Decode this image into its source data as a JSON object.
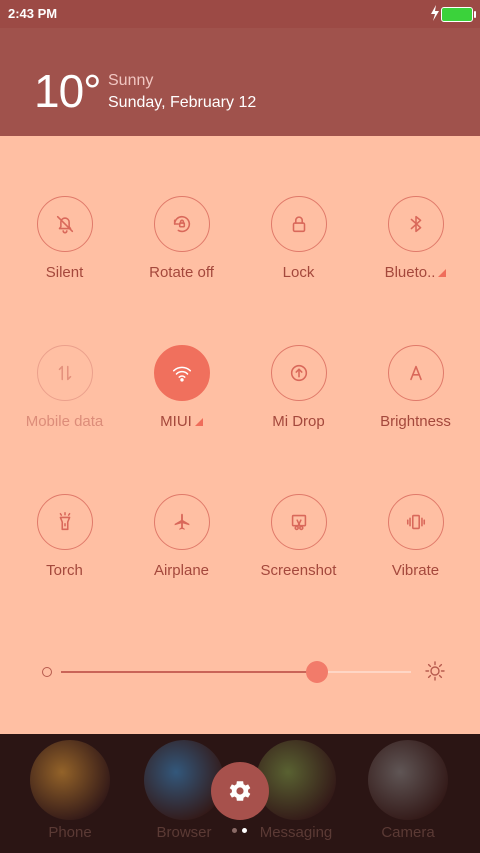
{
  "status_bar": {
    "time": "2:43 PM",
    "battery_color": "#3bd23b"
  },
  "weather": {
    "temperature": "10°",
    "condition": "Sunny",
    "date": "Sunday, February 12"
  },
  "toggles": [
    {
      "label": "Silent",
      "icon": "bell-off-icon",
      "state": "off"
    },
    {
      "label": "Rotate off",
      "icon": "rotate-lock-icon",
      "state": "off"
    },
    {
      "label": "Lock",
      "icon": "lock-icon",
      "state": "off"
    },
    {
      "label": "Blueto..",
      "icon": "bluetooth-icon",
      "state": "off",
      "has_submenu": true
    },
    {
      "label": "Mobile data",
      "icon": "mobile-data-icon",
      "state": "disabled"
    },
    {
      "label": "MIUI",
      "icon": "wifi-icon",
      "state": "on",
      "has_submenu": true
    },
    {
      "label": "Mi Drop",
      "icon": "upload-icon",
      "state": "off"
    },
    {
      "label": "Brightness",
      "icon": "auto-brightness-icon",
      "state": "off"
    },
    {
      "label": "Torch",
      "icon": "flashlight-icon",
      "state": "off"
    },
    {
      "label": "Airplane",
      "icon": "airplane-icon",
      "state": "off"
    },
    {
      "label": "Screenshot",
      "icon": "screenshot-icon",
      "state": "off"
    },
    {
      "label": "Vibrate",
      "icon": "vibrate-icon",
      "state": "off"
    }
  ],
  "brightness": {
    "level": 0.73
  },
  "home_apps": [
    {
      "label": "Phone",
      "color": "#e8a23a"
    },
    {
      "label": "Browser",
      "color": "#3a8ed0"
    },
    {
      "label": "Messaging",
      "color": "#7fa04a"
    },
    {
      "label": "Camera",
      "color": "#8a8a8a"
    }
  ],
  "page_indicator": {
    "count": 2,
    "active": 1
  },
  "colors": {
    "accent": "#f0705d",
    "panel": "#ffbfa3",
    "header": "#a0524c"
  }
}
